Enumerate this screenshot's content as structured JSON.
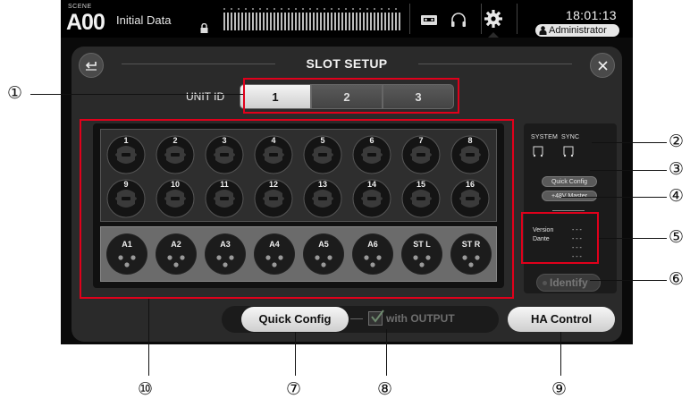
{
  "status_bar": {
    "scene_label": "SCENE",
    "scene_number": "A00",
    "scene_name": "Initial Data",
    "clock": "18:01:13",
    "user": "Administrator"
  },
  "dialog": {
    "title": "SLOT SETUP",
    "back_icon": "back-arrow-icon",
    "close_icon": "close-icon",
    "unit_id": {
      "label": "UNIT ID",
      "options": [
        "1",
        "2",
        "3"
      ],
      "selected": "1"
    },
    "inputs": [
      "1",
      "2",
      "3",
      "4",
      "5",
      "6",
      "7",
      "8",
      "9",
      "10",
      "11",
      "12",
      "13",
      "14",
      "15",
      "16"
    ],
    "outputs": [
      "A1",
      "A2",
      "A3",
      "A4",
      "A5",
      "A6",
      "ST L",
      "ST R"
    ],
    "status": {
      "system_label": "SYSTEM",
      "sync_label": "SYNC",
      "quick_config_indicator": "Quick Config",
      "phantom_master": "+48V Master",
      "version_label": "Version",
      "dante_label": "Dante",
      "values": [
        "- - -",
        "- - -",
        "- - -",
        "- - -"
      ],
      "identify": "Identify"
    },
    "quick_config_button": "Quick Config",
    "with_output_label": "with OUTPUT",
    "with_output_checked": true,
    "ha_control_button": "HA Control"
  },
  "callouts": [
    "①",
    "②",
    "③",
    "④",
    "⑤",
    "⑥",
    "⑦",
    "⑧",
    "⑨",
    "⑩"
  ],
  "colors": {
    "highlight": "#e0001b",
    "screen_bg": "#0a0a0a",
    "dialog_bg": "#2a2a2a"
  }
}
